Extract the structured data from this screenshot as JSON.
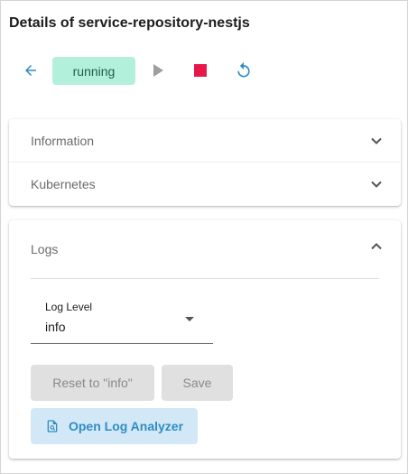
{
  "header": {
    "title": "Details of service-repository-nestjs"
  },
  "toolbar": {
    "back_icon": "arrow-left-icon",
    "status": "running",
    "status_color": "#b3f0dc",
    "start_icon": "play-icon",
    "stop_icon": "stop-icon",
    "stop_color": "#e8174a",
    "restart_icon": "restart-icon",
    "accent_color": "#2f8dc4"
  },
  "panels": [
    {
      "label": "Information",
      "expanded": false
    },
    {
      "label": "Kubernetes",
      "expanded": false
    }
  ],
  "logs": {
    "title": "Logs",
    "expanded": true,
    "log_level_label": "Log Level",
    "log_level_value": "info",
    "reset_button": "Reset to \"info\"",
    "save_button": "Save",
    "analyzer_button": "Open Log Analyzer",
    "analyzer_icon": "document-search-icon"
  }
}
